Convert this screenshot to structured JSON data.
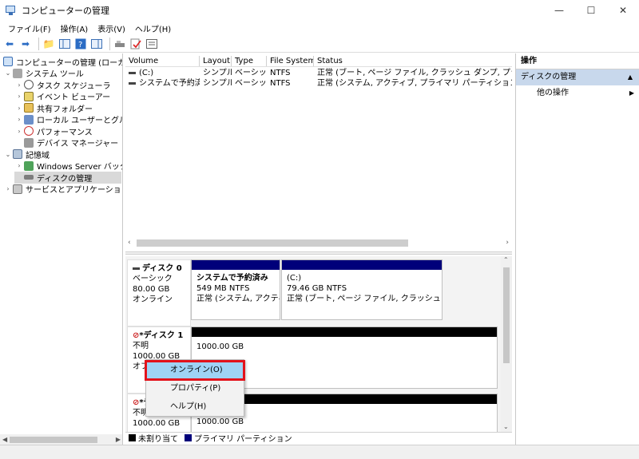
{
  "window": {
    "title": "コンピューターの管理",
    "controls": [
      "minimize",
      "maximize",
      "close"
    ]
  },
  "menu": [
    "ファイル(F)",
    "操作(A)",
    "表示(V)",
    "ヘルプ(H)"
  ],
  "toolbar_icons": [
    "back-arrow-icon",
    "forward-arrow-icon",
    "up-folder-icon",
    "show-tree-icon",
    "help-icon",
    "panel-icon",
    "rescan-icon",
    "check-icon",
    "properties-icon"
  ],
  "tree": [
    {
      "label": "コンピューターの管理 (ローカル)",
      "icon": "computer-icon",
      "expander": ""
    },
    {
      "label": "システム ツール",
      "icon": "tools-icon",
      "expander": "⌄"
    },
    {
      "label": "タスク スケジューラ",
      "icon": "clock-icon",
      "expander": "›"
    },
    {
      "label": "イベント ビューアー",
      "icon": "event-icon",
      "expander": "›"
    },
    {
      "label": "共有フォルダー",
      "icon": "folder-icon",
      "expander": "›"
    },
    {
      "label": "ローカル ユーザーとグループ",
      "icon": "users-icon",
      "expander": "›"
    },
    {
      "label": "パフォーマンス",
      "icon": "performance-icon",
      "expander": "›"
    },
    {
      "label": "デバイス マネージャー",
      "icon": "device-icon",
      "expander": ""
    },
    {
      "label": "記憶域",
      "icon": "storage-icon",
      "expander": "⌄"
    },
    {
      "label": "Windows Server バックアッ",
      "icon": "backup-icon",
      "expander": "›"
    },
    {
      "label": "ディスクの管理",
      "icon": "disk-icon",
      "expander": ""
    },
    {
      "label": "サービスとアプリケーション",
      "icon": "services-icon",
      "expander": "›"
    }
  ],
  "volumes": {
    "headers": [
      "Volume",
      "Layout",
      "Type",
      "File System",
      "Status"
    ],
    "rows": [
      [
        "(C:)",
        "シンプル",
        "ベーシック",
        "NTFS",
        "正常 (ブート, ページ ファイル, クラッシュ ダンプ, プライマリ パーティション)"
      ],
      [
        "システムで予約済み",
        "シンプル",
        "ベーシック",
        "NTFS",
        "正常 (システム, アクティブ, プライマリ パーティション)"
      ]
    ]
  },
  "disks": [
    {
      "name": "ディスク 0",
      "type": "ベーシック",
      "size": "80.00 GB",
      "state": "オンライン",
      "partitions": [
        {
          "name": "システムで予約済み",
          "size": "549 MB NTFS",
          "status": "正常 (システム, アクティブ, プ"
        },
        {
          "name": "(C:)",
          "size": "79.46 GB NTFS",
          "status": "正常 (ブート, ページ ファイル, クラッシュ ダンプ, プライマ"
        }
      ]
    },
    {
      "name": "*ディスク 1",
      "type": "不明",
      "size": "1000.00 GB",
      "state": "オフ",
      "unallocated": "1000.00 GB"
    },
    {
      "name": "*デ",
      "type": "不明",
      "size": "1000.00 GB",
      "unallocated": "1000.00 GB"
    }
  ],
  "legend": [
    "未割り当て",
    "プライマリ パーティション"
  ],
  "actions": {
    "header": "操作",
    "section": "ディスクの管理",
    "item": "他の操作"
  },
  "context_menu": [
    "オンライン(O)",
    "プロパティ(P)",
    "ヘルプ(H)"
  ],
  "colors": {
    "primary_partition": "#00007a",
    "unallocated": "#000000",
    "action_section": "#c8d8ec",
    "menu_highlight": "#9fd3f5",
    "highlight_border": "#e3121b"
  }
}
